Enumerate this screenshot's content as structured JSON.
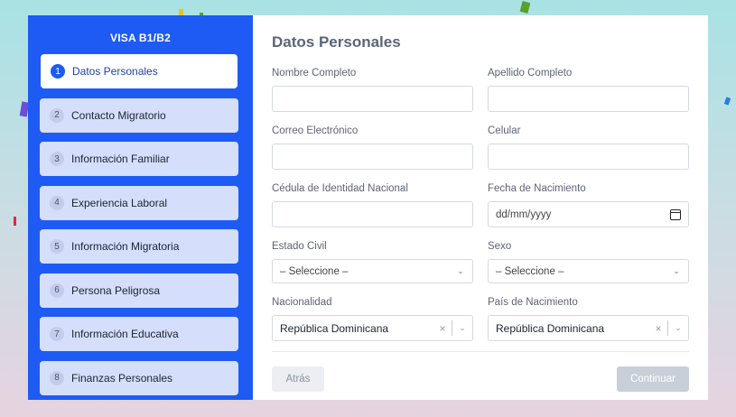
{
  "sidebar": {
    "title": "VISA B1/B2",
    "steps": [
      {
        "num": "1",
        "label": "Datos Personales"
      },
      {
        "num": "2",
        "label": "Contacto Migratorio"
      },
      {
        "num": "3",
        "label": "Información Familiar"
      },
      {
        "num": "4",
        "label": "Experiencia Laboral"
      },
      {
        "num": "5",
        "label": "Información Migratoria"
      },
      {
        "num": "6",
        "label": "Persona Peligrosa"
      },
      {
        "num": "7",
        "label": "Información Educativa"
      },
      {
        "num": "8",
        "label": "Finanzas Personales"
      }
    ],
    "active_step": "1",
    "color": "#1e5bf5"
  },
  "form": {
    "title": "Datos Personales",
    "nombre_label": "Nombre Completo",
    "nombre_value": "",
    "apellido_label": "Apellido Completo",
    "apellido_value": "",
    "correo_label": "Correo Electrónico",
    "correo_value": "",
    "celular_label": "Celular",
    "celular_value": "",
    "cedula_label": "Cédula de Identidad Nacional",
    "cedula_value": "",
    "fecha_label": "Fecha de Nacimiento",
    "fecha_placeholder": "dd/mm/yyyy",
    "estado_label": "Estado Civil",
    "estado_value": "– Seleccione –",
    "sexo_label": "Sexo",
    "sexo_value": "– Seleccione –",
    "nacionalidad_label": "Nacionalidad",
    "nacionalidad_value": "República Dominicana",
    "pais_label": "País de Nacimiento",
    "pais_value": "República Dominicana"
  },
  "buttons": {
    "back": "Atrás",
    "next": "Continuar"
  },
  "icons": {
    "clear": "×",
    "chevron": "⌄"
  }
}
